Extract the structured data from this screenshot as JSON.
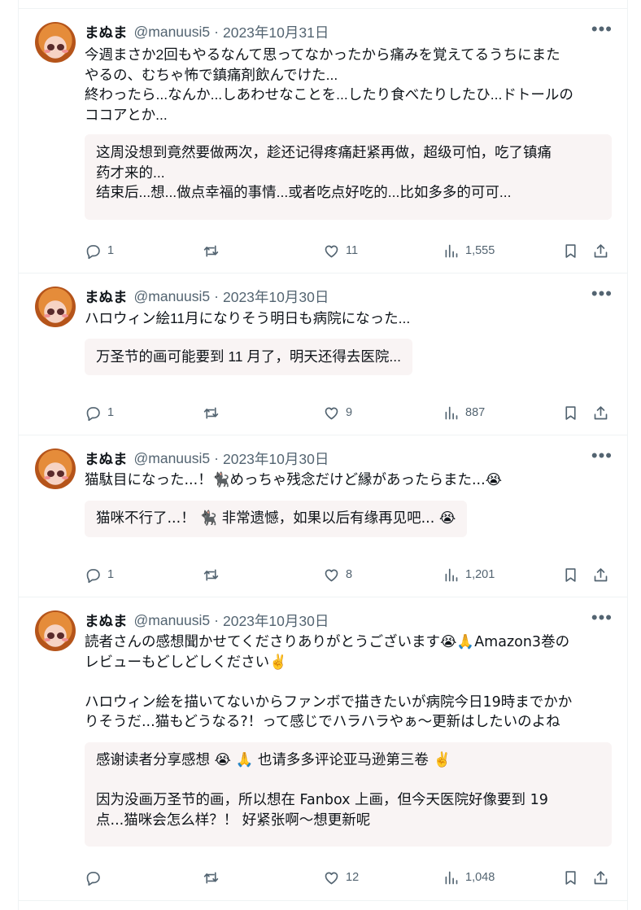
{
  "tweets": [
    {
      "name": "まぬま",
      "handle": "@manuusi5",
      "date": "2023年10月31日",
      "text": "今週まさか2回もやるなんて思ってなかったから痛みを覚えてるうちにまた\nやるの、むちゃ怖で鎮痛剤飲んでけた...\n終わったら...なんか...しあわせなことを...したり食べたりしたひ...ドトールの\nココアとか...",
      "translation": "这周没想到竟然要做两次，趁还记得疼痛赶紧再做，超级可怕，吃了镇痛\n药才来的...\n结束后...想...做点幸福的事情...或者吃点好吃的...比如多多的可可...",
      "replies": "1",
      "retweets": "",
      "likes": "11",
      "views": "1,555"
    },
    {
      "name": "まぬま",
      "handle": "@manuusi5",
      "date": "2023年10月30日",
      "text": "ハロウィン絵11月になりそう明日も病院になった...",
      "translation": "万圣节的画可能要到 11 月了，明天还得去医院...",
      "replies": "1",
      "retweets": "",
      "likes": "9",
      "views": "887"
    },
    {
      "name": "まぬま",
      "handle": "@manuusi5",
      "date": "2023年10月30日",
      "text": "猫駄目になった...！🐈‍⬛めっちゃ残念だけど縁があったらまた...😭",
      "translation": "猫咪不行了...！ 🐈‍⬛ 非常遗憾，如果以后有缘再见吧... 😭",
      "replies": "1",
      "retweets": "",
      "likes": "8",
      "views": "1,201"
    },
    {
      "name": "まぬま",
      "handle": "@manuusi5",
      "date": "2023年10月30日",
      "text": "読者さんの感想聞かせてくださりありがとうございます😭🙏Amazon3巻の\nレビューもどしどしください✌️\n\nハロウィン絵を描いてないからファンボで描きたいが病院今日19時までかか\nりそうだ...猫もどうなる?！って感じでハラハラやぁ～更新はしたいのよね",
      "translation": "感谢读者分享感想 😭 🙏 也请多多评论亚马逊第三卷 ✌️\n\n因为没画万圣节的画，所以想在 Fanbox 上画，但今天医院好像要到 19\n点...猫咪会怎么样？！ 好紧张啊～想更新呢",
      "replies": "",
      "retweets": "",
      "likes": "12",
      "views": "1,048"
    }
  ],
  "icons": {
    "reply": "reply-icon",
    "retweet": "retweet-icon",
    "like": "heart-icon",
    "views": "views-icon",
    "bookmark": "bookmark-icon",
    "share": "share-icon",
    "more": "more-icon"
  },
  "colors": {
    "muted": "#536471",
    "translation_bg": "#f9f4f4",
    "text": "#0f1419"
  }
}
